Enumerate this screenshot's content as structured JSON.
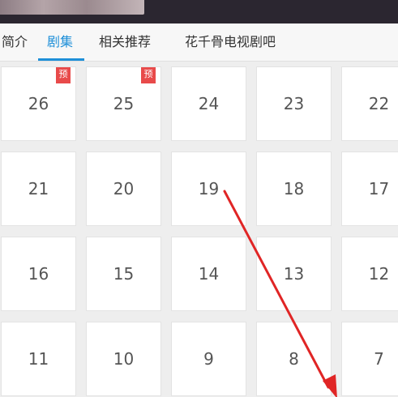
{
  "tabs": [
    {
      "label": "简介",
      "active": false
    },
    {
      "label": "剧集",
      "active": true
    },
    {
      "label": "相关推荐",
      "active": false
    },
    {
      "label": "花千骨电视剧吧",
      "active": false
    }
  ],
  "colors": {
    "accent": "#1e8fd8",
    "badge": "#e84a4a",
    "annotation": "#e02525"
  },
  "episodes": [
    {
      "num": "26",
      "badge": "预"
    },
    {
      "num": "25",
      "badge": "预"
    },
    {
      "num": "24",
      "badge": ""
    },
    {
      "num": "23",
      "badge": ""
    },
    {
      "num": "22",
      "badge": ""
    },
    {
      "num": "21",
      "badge": ""
    },
    {
      "num": "20",
      "badge": ""
    },
    {
      "num": "19",
      "badge": ""
    },
    {
      "num": "18",
      "badge": ""
    },
    {
      "num": "17",
      "badge": ""
    },
    {
      "num": "16",
      "badge": ""
    },
    {
      "num": "15",
      "badge": ""
    },
    {
      "num": "14",
      "badge": ""
    },
    {
      "num": "13",
      "badge": ""
    },
    {
      "num": "12",
      "badge": ""
    },
    {
      "num": "11",
      "badge": ""
    },
    {
      "num": "10",
      "badge": ""
    },
    {
      "num": "9",
      "badge": ""
    },
    {
      "num": "8",
      "badge": ""
    },
    {
      "num": "7",
      "badge": ""
    }
  ]
}
